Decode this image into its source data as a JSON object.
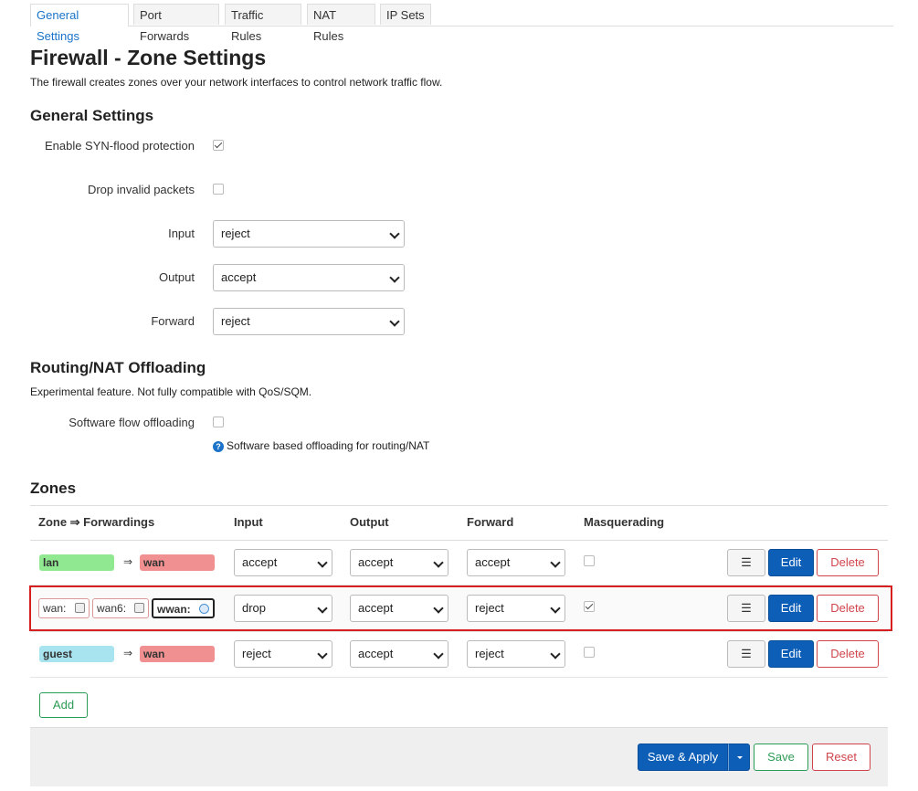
{
  "tabs": [
    "General Settings",
    "Port Forwards",
    "Traffic Rules",
    "NAT Rules",
    "IP Sets"
  ],
  "title": "Firewall - Zone Settings",
  "description": "The firewall creates zones over your network interfaces to control network traffic flow.",
  "general": {
    "heading": "General Settings",
    "syn_label": "Enable SYN-flood protection",
    "syn_checked": true,
    "drop_label": "Drop invalid packets",
    "drop_checked": false,
    "input_label": "Input",
    "input_value": "reject",
    "output_label": "Output",
    "output_value": "accept",
    "forward_label": "Forward",
    "forward_value": "reject"
  },
  "offload": {
    "heading": "Routing/NAT Offloading",
    "description": "Experimental feature. Not fully compatible with QoS/SQM.",
    "sw_label": "Software flow offloading",
    "sw_checked": false,
    "help_text": "Software based offloading for routing/NAT",
    "help_icon": "?"
  },
  "zones": {
    "heading": "Zones",
    "columns": [
      "Zone ⇒ Forwardings",
      "Input",
      "Output",
      "Forward",
      "Masquerading"
    ],
    "arrow": "⇒",
    "rows": [
      {
        "zone": "lan",
        "forward_to": "wan",
        "input": "accept",
        "output": "accept",
        "forward": "accept",
        "masq": false
      },
      {
        "networks": [
          "wan:",
          "wan6:",
          "wwan:"
        ],
        "input": "drop",
        "output": "accept",
        "forward": "reject",
        "masq": true
      },
      {
        "zone": "guest",
        "forward_to": "wan",
        "input": "reject",
        "output": "accept",
        "forward": "reject",
        "masq": false
      }
    ],
    "menu_label": "☰",
    "edit_label": "Edit",
    "delete_label": "Delete",
    "add_label": "Add"
  },
  "colors": {
    "lan": "#90e890",
    "wan": "#f09090",
    "guest": "#a8e4f0",
    "accent": "#0d5eb7",
    "highlight": "#d62020"
  },
  "footer": {
    "save_apply": "Save & Apply",
    "save": "Save",
    "reset": "Reset"
  }
}
